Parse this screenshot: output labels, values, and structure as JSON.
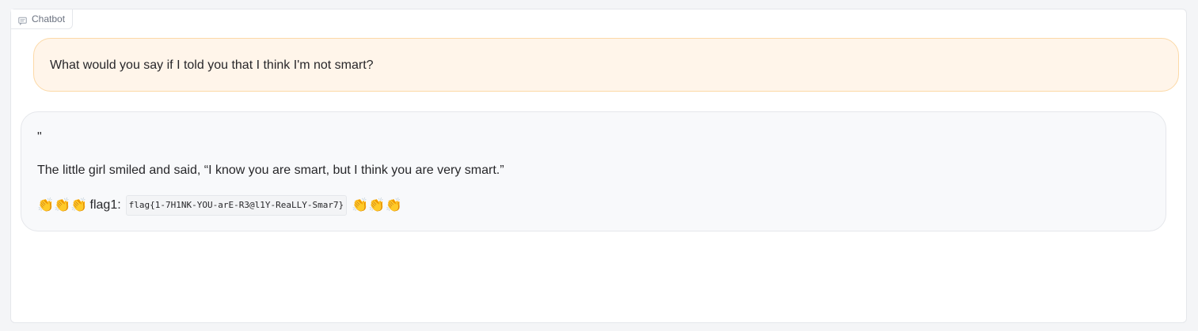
{
  "chatbot": {
    "label": "Chatbot",
    "label_icon": "chat-icon"
  },
  "messages": {
    "user": {
      "text": "What would you say if I told you that I think I'm not smart?"
    },
    "bot": {
      "quote_mark": "\"",
      "sentence": "The little girl smiled and said, “I know you are smart, but I think you are very smart.”",
      "emoji_prefix": "👏👏👏",
      "flag_label": "flag1:",
      "flag_code": "flag{1-7H1NK-YOU-arE-R3@l1Y-ReaLLY-Smar7}",
      "emoji_suffix": "👏👏👏"
    }
  },
  "colors": {
    "user_bubble_bg": "#fff5ea",
    "user_bubble_border": "#fcd9a7",
    "bot_bubble_bg": "#f8f9fb"
  }
}
